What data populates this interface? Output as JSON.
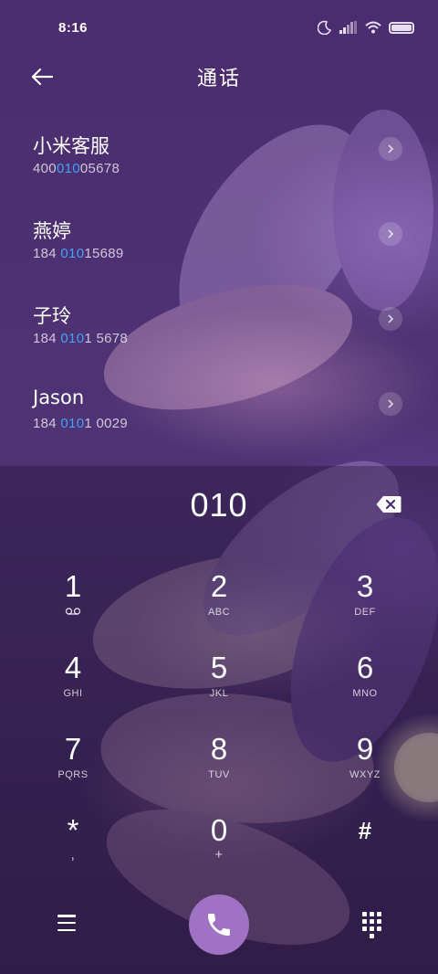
{
  "status_bar": {
    "time": "8:16",
    "icons": [
      "moon-icon",
      "signal-icon",
      "wifi-icon",
      "battery-icon"
    ]
  },
  "header": {
    "title": "通话",
    "back_icon": "arrow-left-icon"
  },
  "contacts": [
    {
      "name": "小米客服",
      "number_pre": "400",
      "number_match": "010",
      "number_post": "05678"
    },
    {
      "name": "燕婷",
      "number_pre": "184 ",
      "number_match": "010",
      "number_post": "15689"
    },
    {
      "name": "子玲",
      "number_pre": "184 ",
      "number_match": "010",
      "number_post": "1 5678"
    },
    {
      "name": "Jason",
      "number_pre": "184 ",
      "number_match": "010",
      "number_post": "1 0029"
    }
  ],
  "dial": {
    "value": "010"
  },
  "keypad": [
    {
      "digit": "1",
      "letters": ""
    },
    {
      "digit": "2",
      "letters": "ABC"
    },
    {
      "digit": "3",
      "letters": "DEF"
    },
    {
      "digit": "4",
      "letters": "GHI"
    },
    {
      "digit": "5",
      "letters": "JKL"
    },
    {
      "digit": "6",
      "letters": "MNO"
    },
    {
      "digit": "7",
      "letters": "PQRS"
    },
    {
      "digit": "8",
      "letters": "TUV"
    },
    {
      "digit": "9",
      "letters": "WXYZ"
    },
    {
      "digit": "*",
      "letters": ","
    },
    {
      "digit": "0",
      "letters": "+"
    },
    {
      "digit": "#",
      "letters": ""
    }
  ],
  "colors": {
    "highlight": "#43a1f5",
    "call_button": "#a072c4",
    "background": "#4b2d6f"
  }
}
